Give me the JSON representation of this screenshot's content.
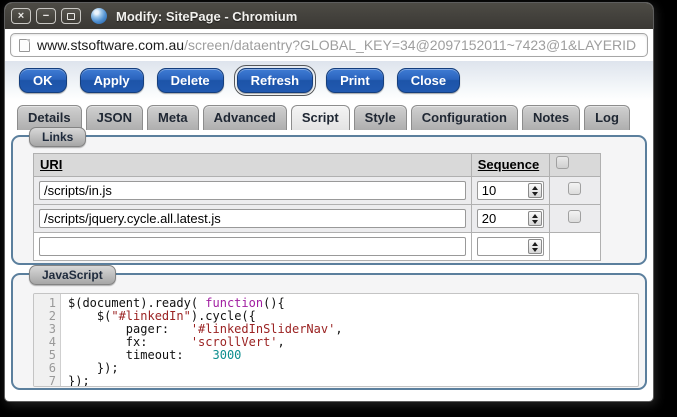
{
  "window": {
    "title": "Modify: SitePage - Chromium",
    "controls": {
      "close": "×",
      "minimize": "−"
    }
  },
  "url": {
    "domain": "www.stsoftware.com.au",
    "path": "/screen/dataentry?GLOBAL_KEY=34@2097152011~7423@1&LAYERID"
  },
  "toolbar": {
    "buttons": [
      {
        "label": "OK"
      },
      {
        "label": "Apply"
      },
      {
        "label": "Delete"
      },
      {
        "label": "Refresh",
        "focused": true
      },
      {
        "label": "Print"
      },
      {
        "label": "Close"
      }
    ]
  },
  "tabs": [
    {
      "label": "Details"
    },
    {
      "label": "JSON"
    },
    {
      "label": "Meta"
    },
    {
      "label": "Advanced"
    },
    {
      "label": "Script",
      "active": true
    },
    {
      "label": "Style"
    },
    {
      "label": "Configuration"
    },
    {
      "label": "Notes"
    },
    {
      "label": "Log"
    }
  ],
  "links": {
    "legend": "Links",
    "headers": {
      "uri": "URI",
      "sequence": "Sequence"
    },
    "rows": [
      {
        "uri": "/scripts/in.js",
        "sequence": "10",
        "has_checkbox": true
      },
      {
        "uri": "/scripts/jquery.cycle.all.latest.js",
        "sequence": "20",
        "has_checkbox": true
      },
      {
        "uri": "",
        "sequence": "",
        "has_checkbox": false
      }
    ]
  },
  "javascript": {
    "legend": "JavaScript",
    "lines": [
      {
        "num": 1,
        "segments": [
          [
            "p",
            "$(document).ready( "
          ],
          [
            "k",
            "function"
          ],
          [
            "p",
            "(){"
          ]
        ]
      },
      {
        "num": 2,
        "segments": [
          [
            "p",
            "    $("
          ],
          [
            "s",
            "\"#linkedIn\""
          ],
          [
            "p",
            ").cycle({"
          ]
        ]
      },
      {
        "num": 3,
        "segments": [
          [
            "p",
            "        pager:   "
          ],
          [
            "s",
            "'#linkedInSliderNav'"
          ],
          [
            "p",
            ","
          ]
        ]
      },
      {
        "num": 4,
        "segments": [
          [
            "p",
            "        fx:      "
          ],
          [
            "s",
            "'scrollVert'"
          ],
          [
            "p",
            ","
          ]
        ]
      },
      {
        "num": 5,
        "segments": [
          [
            "p",
            "        timeout:    "
          ],
          [
            "n",
            "3000"
          ]
        ]
      },
      {
        "num": 6,
        "segments": [
          [
            "p",
            "    });"
          ]
        ]
      },
      {
        "num": 7,
        "segments": [
          [
            "p",
            "});"
          ]
        ]
      }
    ]
  },
  "colors": {
    "button_blue": "#2a63bd",
    "fieldset_border": "#5b7f9d",
    "titlebar": "#3a3834",
    "syntax_keyword": "#a11ea1",
    "syntax_string": "#9b2323",
    "syntax_number": "#0d8e8e"
  }
}
